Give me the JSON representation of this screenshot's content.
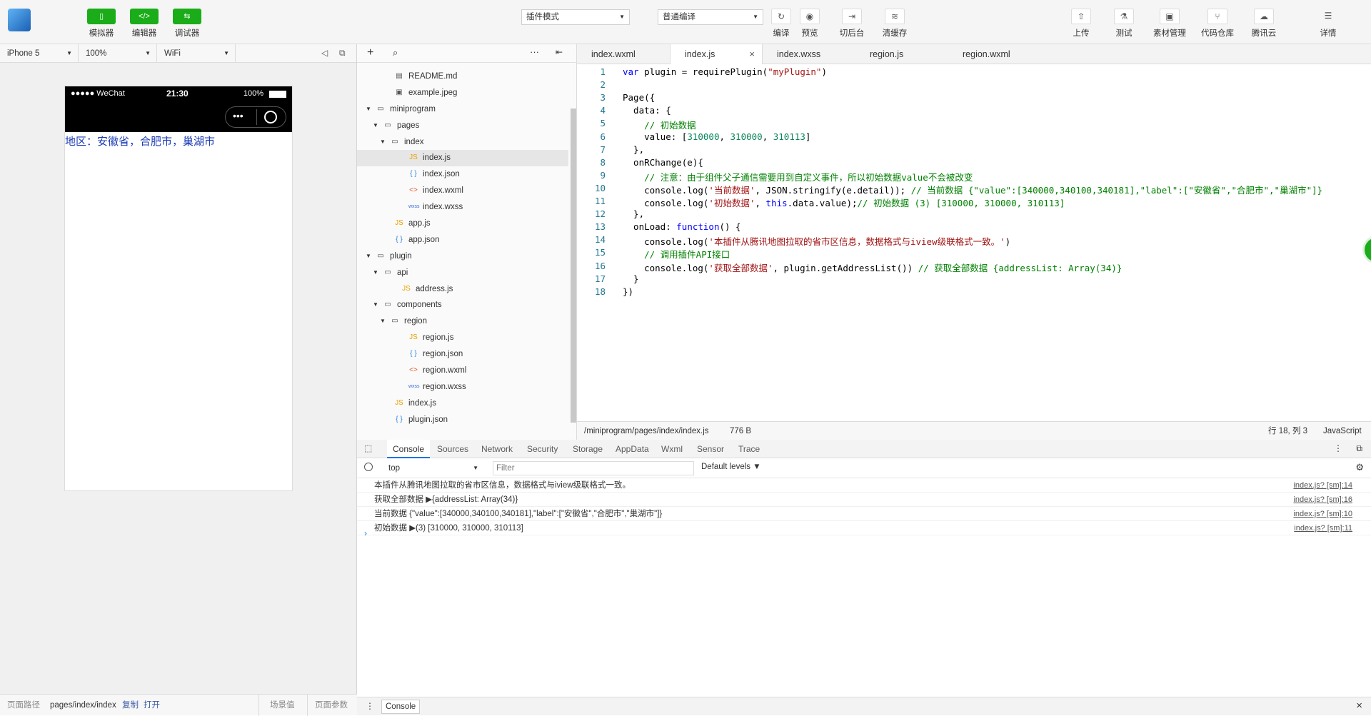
{
  "toolbar": {
    "simulator": "模拟器",
    "editor": "编辑器",
    "debugger": "调试器",
    "mode_select": "插件模式",
    "compile_select": "普通编译",
    "compile": "编译",
    "preview": "预览",
    "background": "切后台",
    "clear_cache": "清缓存",
    "upload": "上传",
    "test": "测试",
    "assets": "素材管理",
    "repo": "代码仓库",
    "tencent_cloud": "腾讯云",
    "details": "详情"
  },
  "device": {
    "model": "iPhone 5",
    "zoom": "100%",
    "network": "WiFi"
  },
  "phone": {
    "carrier": "●●●●● WeChat",
    "time": "21:30",
    "battery": "100%",
    "region_text": "地区：安徽省，合肥市，巢湖市"
  },
  "bottom": {
    "path_label": "页面路径",
    "path": "pages/index/index",
    "copy": "复制",
    "open": "打开",
    "scene": "场景值",
    "params": "页面参数"
  },
  "tree": [
    {
      "name": "README.md",
      "depth": 1,
      "type": "md"
    },
    {
      "name": "example.jpeg",
      "depth": 1,
      "type": "img"
    },
    {
      "name": "miniprogram",
      "depth": 0,
      "type": "folder"
    },
    {
      "name": "pages",
      "depth": 1,
      "type": "folder"
    },
    {
      "name": "index",
      "depth": 2,
      "type": "folder"
    },
    {
      "name": "index.js",
      "depth": 3,
      "type": "js",
      "selected": true
    },
    {
      "name": "index.json",
      "depth": 3,
      "type": "json"
    },
    {
      "name": "index.wxml",
      "depth": 3,
      "type": "wxml"
    },
    {
      "name": "index.wxss",
      "depth": 3,
      "type": "wxss"
    },
    {
      "name": "app.js",
      "depth": 1,
      "type": "js"
    },
    {
      "name": "app.json",
      "depth": 1,
      "type": "json"
    },
    {
      "name": "plugin",
      "depth": 0,
      "type": "folder"
    },
    {
      "name": "api",
      "depth": 1,
      "type": "folder"
    },
    {
      "name": "address.js",
      "depth": 2,
      "type": "js"
    },
    {
      "name": "components",
      "depth": 1,
      "type": "folder"
    },
    {
      "name": "region",
      "depth": 2,
      "type": "folder"
    },
    {
      "name": "region.js",
      "depth": 3,
      "type": "js"
    },
    {
      "name": "region.json",
      "depth": 3,
      "type": "json"
    },
    {
      "name": "region.wxml",
      "depth": 3,
      "type": "wxml"
    },
    {
      "name": "region.wxss",
      "depth": 3,
      "type": "wxss"
    },
    {
      "name": "index.js",
      "depth": 1,
      "type": "js"
    },
    {
      "name": "plugin.json",
      "depth": 1,
      "type": "json"
    }
  ],
  "tabs": [
    "index.wxml",
    "index.js",
    "index.wxss",
    "region.js",
    "region.wxml"
  ],
  "code": [
    "var plugin = requirePlugin(\"myPlugin\")",
    "",
    "Page({",
    "  data: {",
    "    // 初始数据",
    "    value: [310000, 310000, 310113]",
    "  },",
    "  onRChange(e){",
    "    // 注意：由于组件父子通信需要用到自定义事件，所以初始数据value不会被改变",
    "    console.log('当前数据', JSON.stringify(e.detail)); // 当前数据 {\"value\":[340000,340100,340181],\"label\":[\"安徽省\",\"合肥市\",\"巢湖市\"]}",
    "    console.log('初始数据', this.data.value);// 初始数据 (3) [310000, 310000, 310113]",
    "  },",
    "  onLoad: function() {",
    "    console.log('本插件从腾讯地图拉取的省市区信息，数据格式与iview级联格式一致。')",
    "    // 调用插件API接口",
    "    console.log('获取全部数据', plugin.getAddressList()) // 获取全部数据 {addressList: Array(34)}",
    "  }",
    "})"
  ],
  "editor_status": {
    "path": "/miniprogram/pages/index/index.js",
    "size": "776 B",
    "cursor": "行 18, 列 3",
    "lang": "JavaScript"
  },
  "devtools_tabs": [
    "Console",
    "Sources",
    "Network",
    "Security",
    "Storage",
    "AppData",
    "Wxml",
    "Sensor",
    "Trace"
  ],
  "console": {
    "context": "top",
    "filter_placeholder": "Filter",
    "levels": "Default levels",
    "rows": [
      {
        "msg": "本插件从腾讯地图拉取的省市区信息，数据格式与iview级联格式一致。",
        "src": "index.js? [sm]:14"
      },
      {
        "msg": "获取全部数据 ▶{addressList: Array(34)}",
        "src": "index.js? [sm]:16"
      },
      {
        "msg": "当前数据 {\"value\":[340000,340100,340181],\"label\":[\"安徽省\",\"合肥市\",\"巢湖市\"]}",
        "src": "index.js? [sm]:10"
      },
      {
        "msg": "初始数据 ▶(3) [310000, 310000, 310113]",
        "src": "index.js? [sm]:11"
      }
    ],
    "drawer": "Console"
  }
}
